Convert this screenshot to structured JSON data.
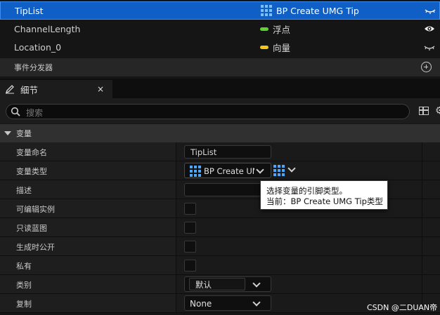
{
  "variables": [
    {
      "name": "TipList",
      "type_label": "BP Create UMG Tip",
      "type_icon": "grid-array-icon",
      "selected": true,
      "visibility_icon": "eye-closed-icon"
    },
    {
      "name": "ChannelLength",
      "type_label": "浮点",
      "type_color": "#5fd135",
      "visibility_icon": "eye-open-icon"
    },
    {
      "name": "Location_0",
      "type_label": "向量",
      "type_color": "#f5c518",
      "visibility_icon": "eye-closed-icon"
    }
  ],
  "event_dispatchers": {
    "label": "事件分发器",
    "add_icon": "plus-circle-icon"
  },
  "details_tab": {
    "title": "细节",
    "close": "×"
  },
  "search": {
    "placeholder": "搜索"
  },
  "category": {
    "label": "变量"
  },
  "properties": {
    "variable_name": {
      "label": "变量命名",
      "value": "TipList"
    },
    "variable_type": {
      "label": "变量类型",
      "value": "BP Create UM"
    },
    "description": {
      "label": "描述"
    },
    "instance_editable": {
      "label": "可编辑实例"
    },
    "blueprint_read_only": {
      "label": "只读蓝图"
    },
    "expose_on_spawn": {
      "label": "生成时公开"
    },
    "private": {
      "label": "私有"
    },
    "category": {
      "label": "类别",
      "value": "默认"
    },
    "replication": {
      "label": "复制",
      "value": "None"
    }
  },
  "tooltip": {
    "line1": "选择变量的引脚类型。",
    "line2": "当前：BP Create UMG Tip类型"
  },
  "watermark": "CSDN @二DUAN帝",
  "colors": {
    "selection": "#0f5fc7",
    "array_icon": "#4aa6ff"
  }
}
